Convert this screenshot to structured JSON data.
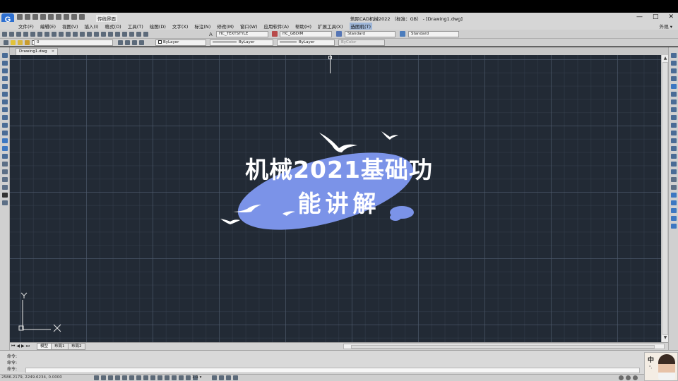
{
  "app": {
    "title": "筑际CAD机械2022 （标准：GB） - [Drawing1.dwg]",
    "logo_text": "G",
    "workspace_label": "传统界面",
    "window_controls": [
      "—",
      "□",
      "✕"
    ]
  },
  "menu": {
    "items": [
      "文件(F)",
      "编辑(E)",
      "视图(V)",
      "插入(I)",
      "格式(O)",
      "工具(T)",
      "绘图(D)",
      "文字(X)",
      "标注(N)",
      "修改(M)",
      "窗口(W)",
      "应用软件(A)",
      "帮助(H)",
      "扩展工具(X)",
      "选图机(T)"
    ],
    "active_index": 14,
    "right_label": "外观 ▾"
  },
  "toolbar": {
    "text_style": "HC_TEXTSTYLE",
    "dim_style": "HC_GBDIM",
    "table_style": "Standard",
    "multileader_style": "Standard",
    "layer": "0",
    "color": "ByLayer",
    "linetype": "ByLayer",
    "lineweight": "ByLayer",
    "plotstyle": "ByColor"
  },
  "document": {
    "tab_label": "Drawing1.dwg",
    "tab_close": "×"
  },
  "canvas": {
    "background": "#222a35",
    "ucs_y_label": "Y",
    "ucs_x_label": "X"
  },
  "overlay": {
    "title_line1": "机械2021基础功",
    "title_line2": "能讲解",
    "blob_color": "#7b93e8"
  },
  "layout_tabs": [
    "模型",
    "布局1",
    "布局2"
  ],
  "nav_arrows": [
    "⏮",
    "◀",
    "▶",
    "⏭"
  ],
  "command": {
    "lines": [
      "命令:",
      "命令:",
      "命令:"
    ]
  },
  "status": {
    "coords": "2586.2179, 2249.6234, 0.0000",
    "scale": "1:1 ▾"
  },
  "ime": {
    "label": "中",
    "sub": "°,"
  }
}
